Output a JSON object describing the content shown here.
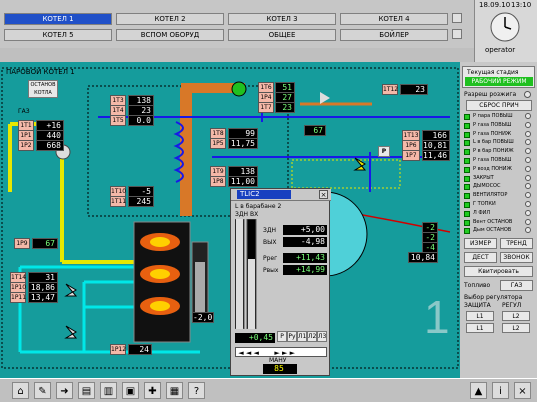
{
  "top_tabs": [
    {
      "label": "КОТЕЛ 1",
      "active": true
    },
    {
      "label": "КОТЕЛ 2",
      "active": false
    },
    {
      "label": "КОТЕЛ 3",
      "active": false
    },
    {
      "label": "КОТЕЛ 4",
      "active": false
    },
    {
      "label": "КОТЕЛ 5",
      "active": false
    },
    {
      "label": "ВСПОМ ОБОРУД",
      "active": false
    },
    {
      "label": "ОБЩЕЕ",
      "active": false
    },
    {
      "label": "БОЙЛЕР",
      "active": false
    }
  ],
  "date": "18.09.10",
  "time": "13:10",
  "user": "operator",
  "boiler_title": "ПАРОВОЙ КОТЕЛ 1",
  "stop_label": "ОСТАНОВ КОТЛА",
  "gas_label": "ГАЗ",
  "left_values": [
    {
      "tag": "1Т1",
      "value": "+16"
    },
    {
      "tag": "1Р1",
      "value": "440"
    },
    {
      "tag": "1Р2",
      "value": "668"
    }
  ],
  "upper_values": [
    {
      "tag": "1Т3",
      "value": "138"
    },
    {
      "tag": "1Т4",
      "value": "23"
    },
    {
      "tag": "1Т5",
      "value": "0.0"
    }
  ],
  "mid_values": [
    {
      "tag": "1Т6",
      "value": "51"
    },
    {
      "tag": "1Р4",
      "value": "27"
    },
    {
      "tag": "1Т7",
      "value": "23"
    }
  ],
  "steam_value": {
    "tag": "1Т12",
    "value": "23"
  },
  "level_values": [
    {
      "tag": "1Т8",
      "value": "99"
    },
    {
      "tag": "1Р5",
      "value": "11,75"
    }
  ],
  "valve_value": "67",
  "right_values": [
    {
      "tag": "1Т13",
      "value": "166"
    },
    {
      "tag": "1Р6",
      "value": "10,81"
    },
    {
      "tag": "1Р7",
      "value": "11,46"
    }
  ],
  "center_values": [
    {
      "tag": "1Т9",
      "value": "138"
    },
    {
      "tag": "1Р8",
      "value": "11,00"
    }
  ],
  "lower_left_values": [
    {
      "tag": "1Т10",
      "value": "-5"
    },
    {
      "tag": "1Т11",
      "value": "245"
    }
  ],
  "burner_values": [
    {
      "tag": "1Р9",
      "value": "67"
    }
  ],
  "bottom_left_values": [
    {
      "tag": "1Т14",
      "value": "31"
    },
    {
      "tag": "1Р10",
      "value": "18,86"
    },
    {
      "tag": "1Р11",
      "value": "13,47"
    }
  ],
  "furnace_value": "-2,0",
  "bottom_value": {
    "tag": "1Р12",
    "value": "24"
  },
  "tl_value": "10,84",
  "tl_values": [
    "-2",
    "-2",
    "-4"
  ],
  "big_number": "1",
  "dialog": {
    "title": "TLIC2",
    "subtitle": "L в барабане 2",
    "units": "ЗДН   ВХ",
    "rows": [
      {
        "label": "ЗДН",
        "value": "+5,00"
      },
      {
        "label": "ВЫХ",
        "value": "-4,98"
      },
      {
        "label": "Ррег",
        "value": "+11,43"
      },
      {
        "label": "Рвых",
        "value": "+14,99"
      }
    ],
    "out_value": "+0,45",
    "mode_buttons": [
      "Р",
      "Ру",
      "Л1",
      "Л2",
      "Л3"
    ],
    "bottom_label": "МАНУ",
    "bottom_value": "85"
  },
  "right_panel": {
    "status_title": "Текущая стадия",
    "status_value": "РАБОЧИЙ РЕЖИМ",
    "resolution": "Разреш розжига",
    "reset_button": "СБРОС ПРИЧ",
    "alarms": [
      "Р пара ПОВЫШ",
      "Р газа ПОВЫШ",
      "Р газа ПОНИЖ",
      "L в бар ПОВЫШ",
      "Р в бар ПОНИЖ",
      "Р газа ПОВЫШ",
      "Р возд ПОНИЖ",
      "ЗАКРЫТ",
      "ДЫМОСОС",
      "ВЕНТИЛЯТОР",
      "Г ТОПКИ",
      "Л ФИЛ",
      "Вент ОСТАНОВ",
      "Дым ОСТАНОВ"
    ],
    "buttons": [
      "ИЗМЕР",
      "ТРЕНД",
      "ДЕСТ",
      "ЗВОНОК"
    ],
    "confirm": "Квитировать",
    "fuel_label": "Топливо",
    "fuel_value": "ГАЗ",
    "choice_label": "Выбор регулятора",
    "protect_label": "ЗАЩИТА",
    "reg_label": "РЕГУЛ",
    "sel": [
      "L1",
      "L2",
      "L1",
      "L2"
    ]
  },
  "colors": {
    "background": "#159c9c",
    "pipe_orange": "#d87828",
    "pipe_yellow": "#e8e800",
    "pipe_cyan": "#00e8e8",
    "pipe_blue": "#1818e8",
    "alarm_red": "#d00000"
  }
}
